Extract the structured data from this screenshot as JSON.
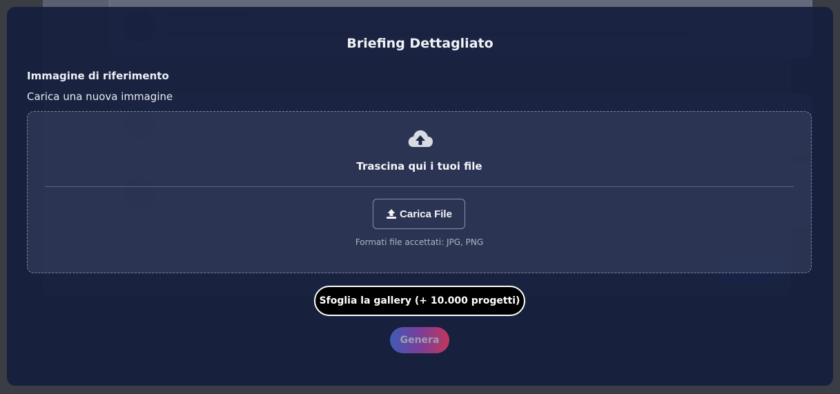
{
  "modal": {
    "title": "Briefing Dettagliato",
    "section_label": "Immagine di riferimento",
    "sub_label": "Carica una nuova immagine"
  },
  "dropzone": {
    "drop_text": "Trascina qui i tuoi file",
    "upload_button": "Carica File",
    "formats": "Formati file accettati: JPG, PNG",
    "icon": "cloud-upload-icon"
  },
  "actions": {
    "gallery_button": "Sfoglia la gallery (+ 10.000 progetti)",
    "generate_button": "Genera"
  },
  "colors": {
    "overlay": "#141e3c",
    "gallery_bg": "#000000",
    "generate_gradient_start": "#3f5bb5",
    "generate_gradient_end": "#c2365c"
  }
}
